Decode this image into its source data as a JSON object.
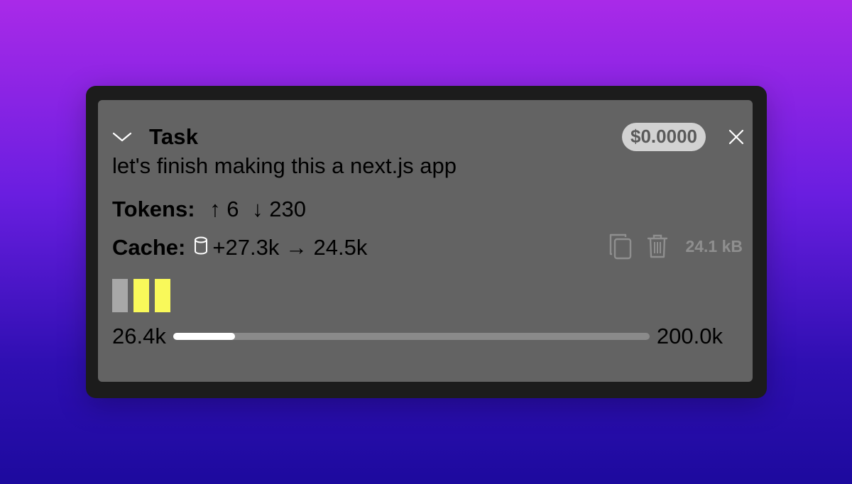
{
  "task": {
    "title": "Task",
    "cost": "$0.0000",
    "description": "let's finish making this a next.js app"
  },
  "tokens": {
    "label": "Tokens:",
    "up": "↑ 6",
    "down": "↓ 230"
  },
  "cache": {
    "label": "Cache:",
    "value": "+27.3k → 24.5k",
    "size": "24.1 kB"
  },
  "context": {
    "used": "26.4k",
    "max": "200.0k",
    "fraction": 0.13,
    "blocks": [
      "#a8a8a8",
      "#f9f95a",
      "#f9f95a"
    ]
  },
  "colors": {
    "panel": "#636363",
    "frame": "#1c1c1c",
    "badge": "#d2d2d2",
    "accent_yellow": "#f9f95a"
  },
  "icons": [
    "chevron-down-icon",
    "close-icon",
    "database-icon",
    "copy-icon",
    "trash-icon"
  ]
}
